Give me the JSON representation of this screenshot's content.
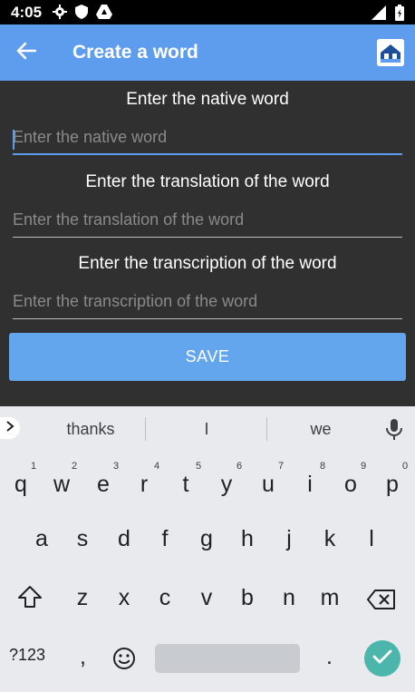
{
  "status_bar": {
    "time": "4:05",
    "left_icons": [
      "gear-icon",
      "shield-icon",
      "drive-icon"
    ],
    "right_icons": [
      "signal-icon",
      "battery-icon"
    ]
  },
  "app_bar": {
    "title": "Create a word",
    "back_icon": "arrow-left-icon",
    "home_icon": "house-icon",
    "color": "#5e9ded"
  },
  "form": {
    "native": {
      "heading": "Enter the native word",
      "placeholder": "Enter the native word",
      "value": ""
    },
    "translation": {
      "heading": "Enter the translation of the word",
      "placeholder": "Enter the translation of the word",
      "value": ""
    },
    "transcription": {
      "heading": "Enter the transcription of the word",
      "placeholder": "Enter the transcription of the word",
      "value": ""
    },
    "save_label": "SAVE",
    "background": "#303030"
  },
  "keyboard": {
    "suggestions": [
      "thanks",
      "I",
      "we"
    ],
    "rows": [
      [
        "q",
        "w",
        "e",
        "r",
        "t",
        "y",
        "u",
        "i",
        "o",
        "p"
      ],
      [
        "a",
        "s",
        "d",
        "f",
        "g",
        "h",
        "j",
        "k",
        "l"
      ],
      [
        "z",
        "x",
        "c",
        "v",
        "b",
        "n",
        "m"
      ]
    ],
    "hints": [
      "1",
      "2",
      "3",
      "4",
      "5",
      "6",
      "7",
      "8",
      "9",
      "0"
    ],
    "symbols_label": "?123",
    "comma": ",",
    "period": ".",
    "enter_color": "#4db6ac"
  }
}
